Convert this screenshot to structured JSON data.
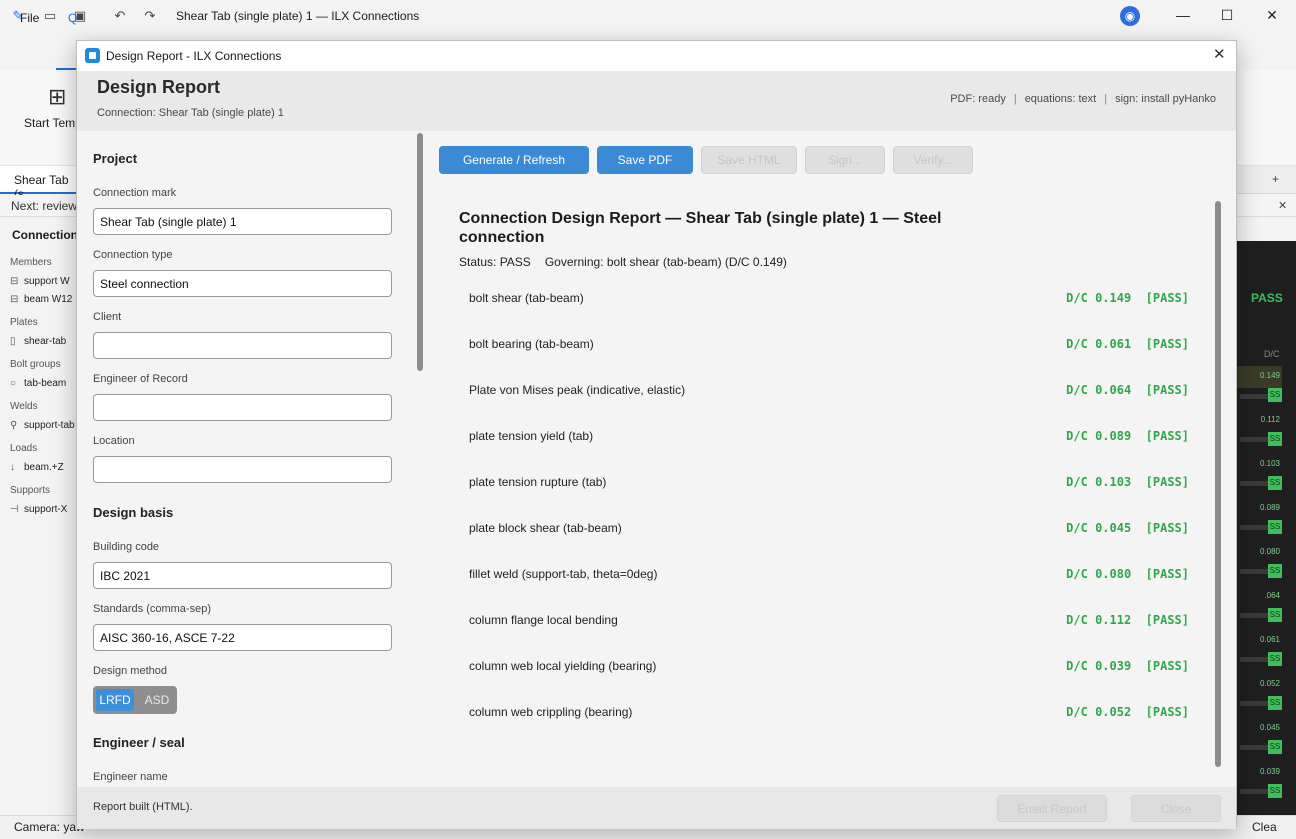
{
  "app": {
    "title": "Shear Tab (single plate) 1 — ILX Connections",
    "menu_file": "File",
    "menu_q": "Q",
    "ribbon_button": "Start Temp",
    "doc_tab": "Shear Tab (s",
    "next_review": "Next: review",
    "tree_title": "Connection",
    "tree": {
      "members_label": "Members",
      "member_1": "support  W",
      "member_2": "beam  W12",
      "plates_label": "Plates",
      "plate_1": "shear-tab",
      "bolts_label": "Bolt groups",
      "bolt_1": "tab-beam",
      "welds_label": "Welds",
      "weld_1": "support-tab",
      "loads_label": "Loads",
      "load_1": "beam.+Z",
      "supports_label": "Supports",
      "support_1": "support-X"
    },
    "side": {
      "pass": "PASS",
      "dc_head": "D/C",
      "values": [
        "0.149",
        "0.112",
        "0.103",
        "0.089",
        "0.080",
        ".064",
        "0.061",
        "0.052",
        "0.045",
        "0.039"
      ],
      "pass_stub": "SS"
    },
    "status_left": "Camera: yaw",
    "status_right": "Clea"
  },
  "dialog": {
    "window_title": "Design Report - ILX Connections",
    "heading": "Design Report",
    "connection_line": "Connection: Shear Tab (single plate) 1",
    "pdf_status": "PDF: ready",
    "equations_status": "equations: text",
    "sign_status": "sign: install pyHanko",
    "toolbar": {
      "generate": "Generate / Refresh",
      "save_pdf": "Save PDF",
      "save_html": "Save HTML",
      "sign": "Sign...",
      "verify": "Verify..."
    },
    "form": {
      "project_section": "Project",
      "connection_mark_label": "Connection mark",
      "connection_mark_value": "Shear Tab (single plate) 1",
      "connection_type_label": "Connection type",
      "connection_type_value": "Steel connection",
      "client_label": "Client",
      "client_value": "",
      "eor_label": "Engineer of Record",
      "eor_value": "",
      "location_label": "Location",
      "location_value": "",
      "design_basis_section": "Design basis",
      "building_code_label": "Building code",
      "building_code_value": "IBC 2021",
      "standards_label": "Standards (comma-sep)",
      "standards_value": "AISC 360-16, ASCE 7-22",
      "design_method_label": "Design method",
      "method_lrfd": "LRFD",
      "method_asd": "ASD",
      "engineer_section": "Engineer / seal",
      "engineer_name_label": "Engineer name"
    },
    "report": {
      "title": "Connection Design Report — Shear Tab (single plate) 1 — Steel connection",
      "status": "Status: PASS",
      "governing": "Governing: bolt shear (tab-beam)  (D/C 0.149)",
      "checks": [
        {
          "name": "bolt shear (tab-beam)",
          "dc": "D/C 0.149  [PASS]"
        },
        {
          "name": "bolt bearing (tab-beam)",
          "dc": "D/C 0.061  [PASS]"
        },
        {
          "name": "Plate von Mises peak (indicative, elastic)",
          "dc": "D/C 0.064  [PASS]"
        },
        {
          "name": "plate tension yield (tab)",
          "dc": "D/C 0.089  [PASS]"
        },
        {
          "name": "plate tension rupture (tab)",
          "dc": "D/C 0.103  [PASS]"
        },
        {
          "name": "plate block shear (tab-beam)",
          "dc": "D/C 0.045  [PASS]"
        },
        {
          "name": "fillet weld (support-tab, theta=0deg)",
          "dc": "D/C 0.080  [PASS]"
        },
        {
          "name": "column flange local bending",
          "dc": "D/C 0.112  [PASS]"
        },
        {
          "name": "column web local yielding (bearing)",
          "dc": "D/C 0.039  [PASS]"
        },
        {
          "name": "column web crippling (bearing)",
          "dc": "D/C 0.052  [PASS]"
        }
      ]
    },
    "footer": {
      "message": "Report built (HTML).",
      "email": "Email Report",
      "close": "Close"
    }
  }
}
